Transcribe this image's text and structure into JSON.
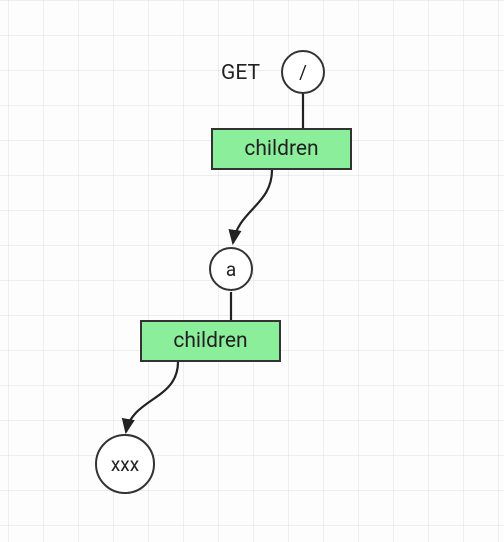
{
  "diagram": {
    "root_label": "GET",
    "nodes": {
      "root": "/",
      "child1_box": "children",
      "mid": "a",
      "child2_box": "children",
      "leaf": "xxx"
    },
    "colors": {
      "box_fill": "#8bee9a",
      "border": "#333333",
      "bg": "#fdfdfd"
    }
  },
  "chart_data": {
    "type": "tree",
    "title": "",
    "nodes": [
      {
        "id": "root",
        "label": "/",
        "side_label": "GET",
        "shape": "circle"
      },
      {
        "id": "c1",
        "label": "children",
        "shape": "rect"
      },
      {
        "id": "a",
        "label": "a",
        "shape": "circle"
      },
      {
        "id": "c2",
        "label": "children",
        "shape": "rect"
      },
      {
        "id": "xxx",
        "label": "xxx",
        "shape": "circle"
      }
    ],
    "edges": [
      {
        "from": "root",
        "to": "c1"
      },
      {
        "from": "c1",
        "to": "a"
      },
      {
        "from": "a",
        "to": "c2"
      },
      {
        "from": "c2",
        "to": "xxx"
      }
    ]
  }
}
